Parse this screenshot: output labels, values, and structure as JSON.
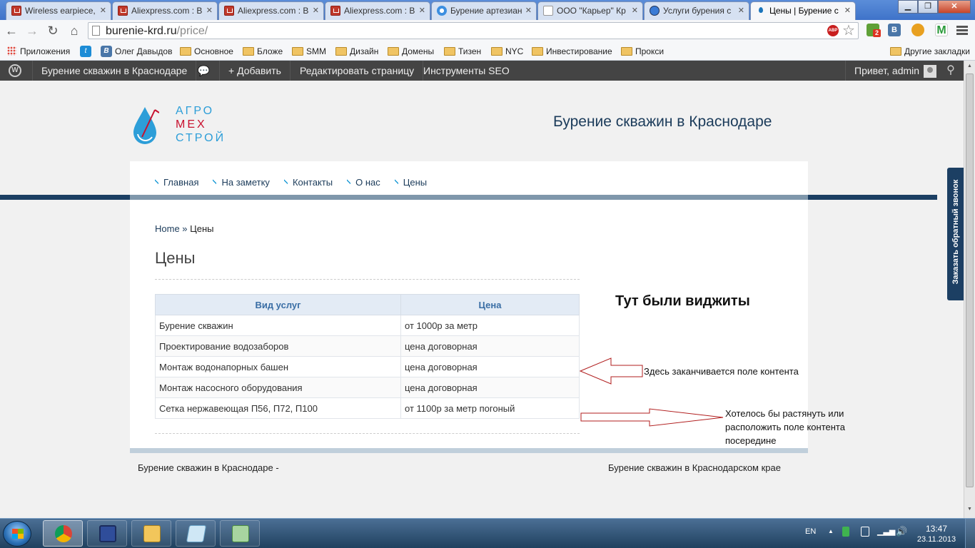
{
  "browser": {
    "tabs": [
      {
        "title": "Wireless earpiece,",
        "icon": "aliexpress-icon"
      },
      {
        "title": "Aliexpress.com : B",
        "icon": "aliexpress-icon"
      },
      {
        "title": "Aliexpress.com : B",
        "icon": "aliexpress-icon"
      },
      {
        "title": "Aliexpress.com : B",
        "icon": "aliexpress-icon"
      },
      {
        "title": "Бурение артезиан",
        "icon": "gear-icon"
      },
      {
        "title": "ООО \"Карьер\" Кр",
        "icon": "document-icon"
      },
      {
        "title": "Услуги бурения с",
        "icon": "globe-icon"
      },
      {
        "title": "Цены | Бурение с",
        "icon": "water-drop-icon"
      }
    ],
    "url_host": "burenie-krd.ru",
    "url_path": "/price/",
    "extensions": {
      "adblock": "ABP",
      "vk": "B",
      "badge": "2"
    }
  },
  "bookmarks": [
    {
      "label": "Приложения",
      "icon": "apps-icon"
    },
    {
      "label": "",
      "icon": "twitter-icon"
    },
    {
      "label": "Олег Давыдов",
      "icon": "vk-icon"
    },
    {
      "label": "Основное",
      "icon": "folder-icon"
    },
    {
      "label": "Бложе",
      "icon": "folder-icon"
    },
    {
      "label": "SMM",
      "icon": "folder-icon"
    },
    {
      "label": "Дизайн",
      "icon": "folder-icon"
    },
    {
      "label": "Домены",
      "icon": "folder-icon"
    },
    {
      "label": "Тизен",
      "icon": "folder-icon"
    },
    {
      "label": "NYC",
      "icon": "folder-icon"
    },
    {
      "label": "Инвестирование",
      "icon": "folder-icon"
    },
    {
      "label": "Прокси",
      "icon": "folder-icon"
    }
  ],
  "bookmarks_other": "Другие закладки",
  "adminbar": {
    "site": "Бурение скважин в Краснодаре",
    "add": "+ Добавить",
    "edit": "Редактировать страницу",
    "seo": "Инструменты SEO",
    "greeting": "Привет, admin"
  },
  "site": {
    "logo_lines": [
      "АГРО",
      "МЕХ",
      "СТРОЙ"
    ],
    "title": "Бурение скважин в Краснодаре",
    "menu": [
      "Главная",
      "На заметку",
      "Контакты",
      "О нас",
      "Цены"
    ],
    "breadcrumb_home": "Home",
    "breadcrumb_sep": " » ",
    "breadcrumb_current": "Цены",
    "page_title": "Цены",
    "callback": "Заказать обратный звонок",
    "widgets_note": "Тут были виджиты",
    "annotation_1": "Здесь заканчивается поле контента",
    "annotation_2": "Хотелось бы растянуть или расположить поле контента посередине",
    "footer_left": "Бурение скважин в Краснодаре -",
    "footer_right": "Бурение скважин в Краснодарском крае"
  },
  "price_table": {
    "headers": [
      "Вид услуг",
      "Цена"
    ],
    "rows": [
      [
        "Бурение скважин",
        "от 1000р за метр"
      ],
      [
        "Проектирование водозаборов",
        "цена договорная"
      ],
      [
        "Монтаж водонапорных башен",
        "цена договорная"
      ],
      [
        "Монтаж насосного оборудования",
        "цена договорная"
      ],
      [
        "Сетка нержавеющая П56, П72, П100",
        "от 1100р за метр погоный"
      ]
    ]
  },
  "taskbar": {
    "lang": "EN",
    "time": "13:47",
    "date": "23.11.2013"
  },
  "colors": {
    "brand_dark": "#1c3f63",
    "accent": "#1b9ad6",
    "logo_red": "#c8102e"
  }
}
